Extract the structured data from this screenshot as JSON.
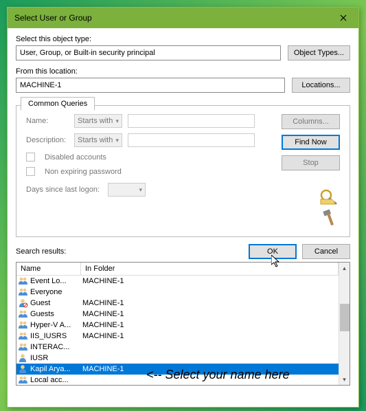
{
  "window": {
    "title": "Select User or Group"
  },
  "labels": {
    "object_type": "Select this object type:",
    "from_location": "From this location:",
    "search_results": "Search results:"
  },
  "fields": {
    "object_type_value": "User, Group, or Built-in security principal",
    "location_value": "MACHINE-1"
  },
  "buttons": {
    "object_types": "Object Types...",
    "locations": "Locations...",
    "columns": "Columns...",
    "find_now": "Find Now",
    "stop": "Stop",
    "ok": "OK",
    "cancel": "Cancel"
  },
  "tab": {
    "label": "Common Queries"
  },
  "query": {
    "name_label": "Name:",
    "desc_label": "Description:",
    "starts_with": "Starts with",
    "disabled_accounts": "Disabled accounts",
    "non_expiring": "Non expiring password",
    "days_label": "Days since last logon:"
  },
  "results": {
    "headers": [
      "Name",
      "In Folder"
    ],
    "rows": [
      {
        "icon": "group",
        "name": "Event Lo...",
        "folder": "MACHINE-1"
      },
      {
        "icon": "group",
        "name": "Everyone",
        "folder": ""
      },
      {
        "icon": "user-disabled",
        "name": "Guest",
        "folder": "MACHINE-1"
      },
      {
        "icon": "group",
        "name": "Guests",
        "folder": "MACHINE-1"
      },
      {
        "icon": "group",
        "name": "Hyper-V A...",
        "folder": "MACHINE-1"
      },
      {
        "icon": "group",
        "name": "IIS_IUSRS",
        "folder": "MACHINE-1"
      },
      {
        "icon": "group",
        "name": "INTERAC...",
        "folder": ""
      },
      {
        "icon": "user",
        "name": "IUSR",
        "folder": ""
      },
      {
        "icon": "user",
        "name": "Kapil Arya...",
        "folder": "MACHINE-1",
        "selected": true
      },
      {
        "icon": "group",
        "name": "Local acc...",
        "folder": ""
      }
    ]
  },
  "annotation": "<-- Select your name here"
}
